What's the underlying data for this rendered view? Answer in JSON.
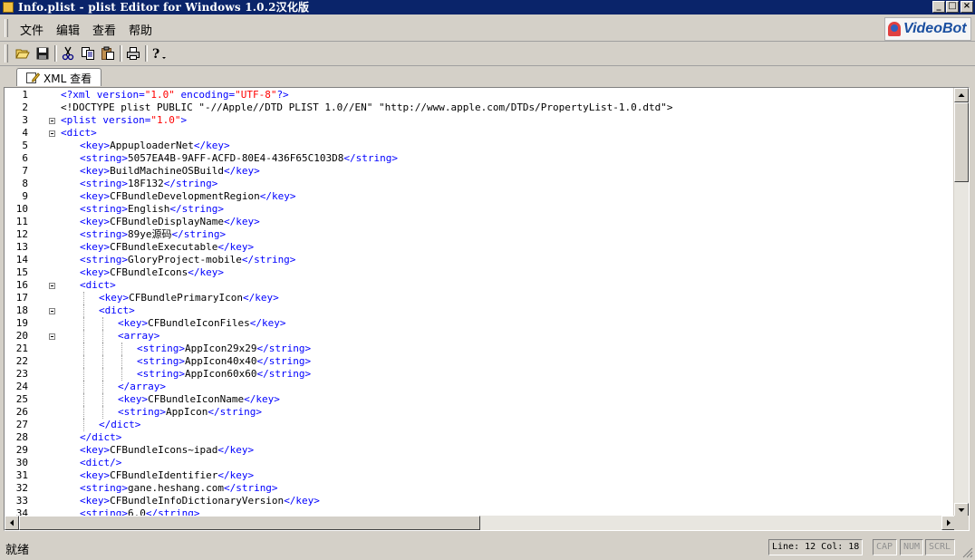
{
  "window": {
    "title": "Info.plist - plist Editor for Windows 1.0.2汉化版",
    "minimize_glyph": "_",
    "maximize_glyph": "□",
    "close_glyph": "×"
  },
  "menu": {
    "items": [
      "文件",
      "编辑",
      "查看",
      "帮助"
    ]
  },
  "logo": {
    "text": "VideoBot"
  },
  "toolbar": {
    "buttons": [
      "open-icon",
      "save-icon",
      "cut-icon",
      "copy-icon",
      "paste-icon",
      "print-icon",
      "help-icon"
    ]
  },
  "tabs": [
    {
      "label": "XML 查看",
      "icon": "document-edit-icon"
    }
  ],
  "editor": {
    "lines": [
      {
        "n": "1",
        "indent": 0,
        "segs": [
          {
            "t": "<?xml version=",
            "c": "b"
          },
          {
            "t": "\"1.0\"",
            "c": "r"
          },
          {
            "t": " encoding=",
            "c": "b"
          },
          {
            "t": "\"UTF-8\"",
            "c": "r"
          },
          {
            "t": "?>",
            "c": "b"
          }
        ]
      },
      {
        "n": "2",
        "indent": 0,
        "segs": [
          {
            "t": "<!DOCTYPE plist PUBLIC \"-//Apple//DTD PLIST 1.0//EN\" \"http://www.apple.com/DTDs/PropertyList-1.0.dtd\">",
            "c": "k"
          }
        ]
      },
      {
        "n": "3",
        "indent": 0,
        "fold": true,
        "segs": [
          {
            "t": "<plist version=",
            "c": "b"
          },
          {
            "t": "\"1.0\"",
            "c": "r"
          },
          {
            "t": ">",
            "c": "b"
          }
        ]
      },
      {
        "n": "4",
        "indent": 0,
        "fold": true,
        "segs": [
          {
            "t": "<dict>",
            "c": "b"
          }
        ]
      },
      {
        "n": "5",
        "indent": 1,
        "segs": [
          {
            "t": "<key>",
            "c": "b"
          },
          {
            "t": "AppuploaderNet",
            "c": "k"
          },
          {
            "t": "</key>",
            "c": "b"
          }
        ]
      },
      {
        "n": "6",
        "indent": 1,
        "segs": [
          {
            "t": "<string>",
            "c": "b"
          },
          {
            "t": "5057EA4B-9AFF-ACFD-80E4-436F65C103D8",
            "c": "k"
          },
          {
            "t": "</string>",
            "c": "b"
          }
        ]
      },
      {
        "n": "7",
        "indent": 1,
        "segs": [
          {
            "t": "<key>",
            "c": "b"
          },
          {
            "t": "BuildMachineOSBuild",
            "c": "k"
          },
          {
            "t": "</key>",
            "c": "b"
          }
        ]
      },
      {
        "n": "8",
        "indent": 1,
        "segs": [
          {
            "t": "<string>",
            "c": "b"
          },
          {
            "t": "18F132",
            "c": "k"
          },
          {
            "t": "</string>",
            "c": "b"
          }
        ]
      },
      {
        "n": "9",
        "indent": 1,
        "segs": [
          {
            "t": "<key>",
            "c": "b"
          },
          {
            "t": "CFBundleDevelopmentRegion",
            "c": "k"
          },
          {
            "t": "</key>",
            "c": "b"
          }
        ]
      },
      {
        "n": "10",
        "indent": 1,
        "segs": [
          {
            "t": "<string>",
            "c": "b"
          },
          {
            "t": "English",
            "c": "k"
          },
          {
            "t": "</string>",
            "c": "b"
          }
        ]
      },
      {
        "n": "11",
        "indent": 1,
        "segs": [
          {
            "t": "<key>",
            "c": "b"
          },
          {
            "t": "CFBundleDisplayName",
            "c": "k"
          },
          {
            "t": "</key>",
            "c": "b"
          }
        ]
      },
      {
        "n": "12",
        "indent": 1,
        "segs": [
          {
            "t": "<string>",
            "c": "b"
          },
          {
            "t": "89ye源码",
            "c": "k"
          },
          {
            "t": "</string>",
            "c": "b"
          }
        ]
      },
      {
        "n": "13",
        "indent": 1,
        "segs": [
          {
            "t": "<key>",
            "c": "b"
          },
          {
            "t": "CFBundleExecutable",
            "c": "k"
          },
          {
            "t": "</key>",
            "c": "b"
          }
        ]
      },
      {
        "n": "14",
        "indent": 1,
        "segs": [
          {
            "t": "<string>",
            "c": "b"
          },
          {
            "t": "GloryProject-mobile",
            "c": "k"
          },
          {
            "t": "</string>",
            "c": "b"
          }
        ]
      },
      {
        "n": "15",
        "indent": 1,
        "segs": [
          {
            "t": "<key>",
            "c": "b"
          },
          {
            "t": "CFBundleIcons",
            "c": "k"
          },
          {
            "t": "</key>",
            "c": "b"
          }
        ]
      },
      {
        "n": "16",
        "indent": 1,
        "fold": true,
        "segs": [
          {
            "t": "<dict>",
            "c": "b"
          }
        ]
      },
      {
        "n": "17",
        "indent": 2,
        "segs": [
          {
            "t": "<key>",
            "c": "b"
          },
          {
            "t": "CFBundlePrimaryIcon",
            "c": "k"
          },
          {
            "t": "</key>",
            "c": "b"
          }
        ]
      },
      {
        "n": "18",
        "indent": 2,
        "fold": true,
        "segs": [
          {
            "t": "<dict>",
            "c": "b"
          }
        ]
      },
      {
        "n": "19",
        "indent": 3,
        "segs": [
          {
            "t": "<key>",
            "c": "b"
          },
          {
            "t": "CFBundleIconFiles",
            "c": "k"
          },
          {
            "t": "</key>",
            "c": "b"
          }
        ]
      },
      {
        "n": "20",
        "indent": 3,
        "fold": true,
        "segs": [
          {
            "t": "<array>",
            "c": "b"
          }
        ]
      },
      {
        "n": "21",
        "indent": 4,
        "segs": [
          {
            "t": "<string>",
            "c": "b"
          },
          {
            "t": "AppIcon29x29",
            "c": "k"
          },
          {
            "t": "</string>",
            "c": "b"
          }
        ]
      },
      {
        "n": "22",
        "indent": 4,
        "segs": [
          {
            "t": "<string>",
            "c": "b"
          },
          {
            "t": "AppIcon40x40",
            "c": "k"
          },
          {
            "t": "</string>",
            "c": "b"
          }
        ]
      },
      {
        "n": "23",
        "indent": 4,
        "segs": [
          {
            "t": "<string>",
            "c": "b"
          },
          {
            "t": "AppIcon60x60",
            "c": "k"
          },
          {
            "t": "</string>",
            "c": "b"
          }
        ]
      },
      {
        "n": "24",
        "indent": 3,
        "segs": [
          {
            "t": "</array>",
            "c": "b"
          }
        ]
      },
      {
        "n": "25",
        "indent": 3,
        "segs": [
          {
            "t": "<key>",
            "c": "b"
          },
          {
            "t": "CFBundleIconName",
            "c": "k"
          },
          {
            "t": "</key>",
            "c": "b"
          }
        ]
      },
      {
        "n": "26",
        "indent": 3,
        "segs": [
          {
            "t": "<string>",
            "c": "b"
          },
          {
            "t": "AppIcon",
            "c": "k"
          },
          {
            "t": "</string>",
            "c": "b"
          }
        ]
      },
      {
        "n": "27",
        "indent": 2,
        "segs": [
          {
            "t": "</dict>",
            "c": "b"
          }
        ]
      },
      {
        "n": "28",
        "indent": 1,
        "segs": [
          {
            "t": "</dict>",
            "c": "b"
          }
        ]
      },
      {
        "n": "29",
        "indent": 1,
        "segs": [
          {
            "t": "<key>",
            "c": "b"
          },
          {
            "t": "CFBundleIcons~ipad",
            "c": "k"
          },
          {
            "t": "</key>",
            "c": "b"
          }
        ]
      },
      {
        "n": "30",
        "indent": 1,
        "segs": [
          {
            "t": "<dict/>",
            "c": "b"
          }
        ]
      },
      {
        "n": "31",
        "indent": 1,
        "segs": [
          {
            "t": "<key>",
            "c": "b"
          },
          {
            "t": "CFBundleIdentifier",
            "c": "k"
          },
          {
            "t": "</key>",
            "c": "b"
          }
        ]
      },
      {
        "n": "32",
        "indent": 1,
        "segs": [
          {
            "t": "<string>",
            "c": "b"
          },
          {
            "t": "gane.heshang.com",
            "c": "k"
          },
          {
            "t": "</string>",
            "c": "b"
          }
        ]
      },
      {
        "n": "33",
        "indent": 1,
        "segs": [
          {
            "t": "<key>",
            "c": "b"
          },
          {
            "t": "CFBundleInfoDictionaryVersion",
            "c": "k"
          },
          {
            "t": "</key>",
            "c": "b"
          }
        ]
      },
      {
        "n": "34",
        "indent": 1,
        "segs": [
          {
            "t": "<string>",
            "c": "b"
          },
          {
            "t": "6.0",
            "c": "k"
          },
          {
            "t": "</string>",
            "c": "b"
          }
        ]
      }
    ]
  },
  "statusbar": {
    "text": "就绪",
    "position": "Line: 12 Col: 18",
    "cap": "CAP",
    "num": "NUM",
    "scrl": "SCRL"
  },
  "scroll": {
    "vertical_position": 0.0,
    "vertical_visible_fraction": 0.2,
    "horizontal_position": 0.0,
    "horizontal_visible_fraction": 0.5
  }
}
